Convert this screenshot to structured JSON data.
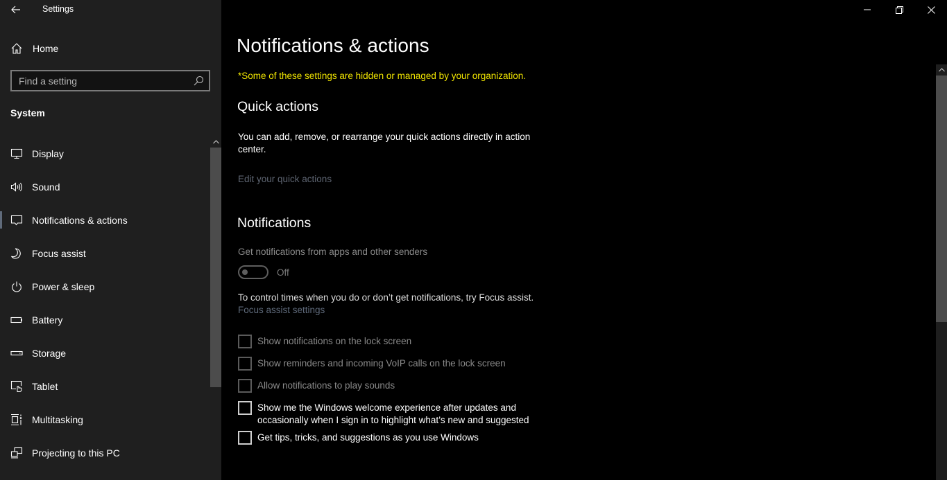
{
  "window": {
    "title": "Settings",
    "controls": {
      "minimize": "minimize",
      "maximize": "restore",
      "close": "close"
    }
  },
  "sidebar": {
    "home_label": "Home",
    "search": {
      "placeholder": "Find a setting",
      "value": ""
    },
    "section_label": "System",
    "selected_index": 2,
    "items": [
      {
        "label": "Display",
        "icon": "monitor-icon"
      },
      {
        "label": "Sound",
        "icon": "speaker-icon"
      },
      {
        "label": "Notifications & actions",
        "icon": "message-icon"
      },
      {
        "label": "Focus assist",
        "icon": "moon-icon"
      },
      {
        "label": "Power & sleep",
        "icon": "power-icon"
      },
      {
        "label": "Battery",
        "icon": "battery-icon"
      },
      {
        "label": "Storage",
        "icon": "storage-icon"
      },
      {
        "label": "Tablet",
        "icon": "tablet-icon"
      },
      {
        "label": "Multitasking",
        "icon": "multitasking-icon"
      },
      {
        "label": "Projecting to this PC",
        "icon": "projecting-icon"
      }
    ]
  },
  "main": {
    "title": "Notifications & actions",
    "org_notice": "*Some of these settings are hidden or managed by your organization.",
    "quick_actions": {
      "heading": "Quick actions",
      "description": "You can add, remove, or rearrange your quick actions directly in action center.",
      "edit_link": "Edit your quick actions"
    },
    "notifications": {
      "heading": "Notifications",
      "get_notifications_label": "Get notifications from apps and other senders",
      "toggle_state": "Off",
      "toggle_on": false,
      "focus_text": "To control times when you do or don’t get notifications, try Focus assist.",
      "focus_link": "Focus assist settings",
      "checkboxes": [
        {
          "label": "Show notifications on the lock screen",
          "checked": false,
          "enabled": false
        },
        {
          "label": "Show reminders and incoming VoIP calls on the lock screen",
          "checked": false,
          "enabled": false
        },
        {
          "label": "Allow notifications to play sounds",
          "checked": false,
          "enabled": false
        },
        {
          "label": "Show me the Windows welcome experience after updates and occasionally when I sign in to highlight what’s new and suggested",
          "checked": false,
          "enabled": true
        },
        {
          "label": "Get tips, tricks, and suggestions as you use Windows",
          "checked": false,
          "enabled": true
        }
      ]
    }
  },
  "colors": {
    "sidebar_bg": "#1f1f1f",
    "main_bg": "#000000",
    "warning_text": "#f2e600",
    "disabled_link": "#5f6673",
    "selection_indicator": "#606b7b"
  }
}
